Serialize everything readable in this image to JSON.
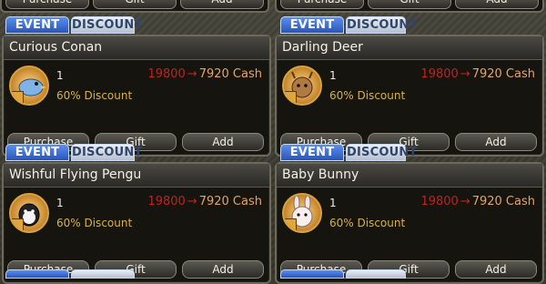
{
  "tabs": {
    "event": "EVENT",
    "discount": "DISCOUNT"
  },
  "buttons": {
    "purchase": "Purchase",
    "gift": "Gift",
    "add": "Add"
  },
  "items": [
    {
      "name": "Curious Conan",
      "qty": "1",
      "orig_price": "19800",
      "arrow": "→",
      "sale_price": "7920 Cash",
      "discount": "60% Discount",
      "icon": "blue-bird-icon"
    },
    {
      "name": "Darling Deer",
      "qty": "1",
      "orig_price": "19800",
      "arrow": "→",
      "sale_price": "7920 Cash",
      "discount": "60% Discount",
      "icon": "deer-icon"
    },
    {
      "name": "Wishful Flying Pengu",
      "qty": "1",
      "orig_price": "19800",
      "arrow": "→",
      "sale_price": "7920 Cash",
      "discount": "60% Discount",
      "icon": "penguin-icon"
    },
    {
      "name": "Baby Bunny",
      "qty": "1",
      "orig_price": "19800",
      "arrow": "→",
      "sale_price": "7920 Cash",
      "discount": "60% Discount",
      "icon": "bunny-icon"
    }
  ],
  "colors": {
    "event_tab": "#2a55b8",
    "price_original": "#c12222",
    "price_sale": "#e3a56a",
    "discount_text": "#d5b245"
  }
}
